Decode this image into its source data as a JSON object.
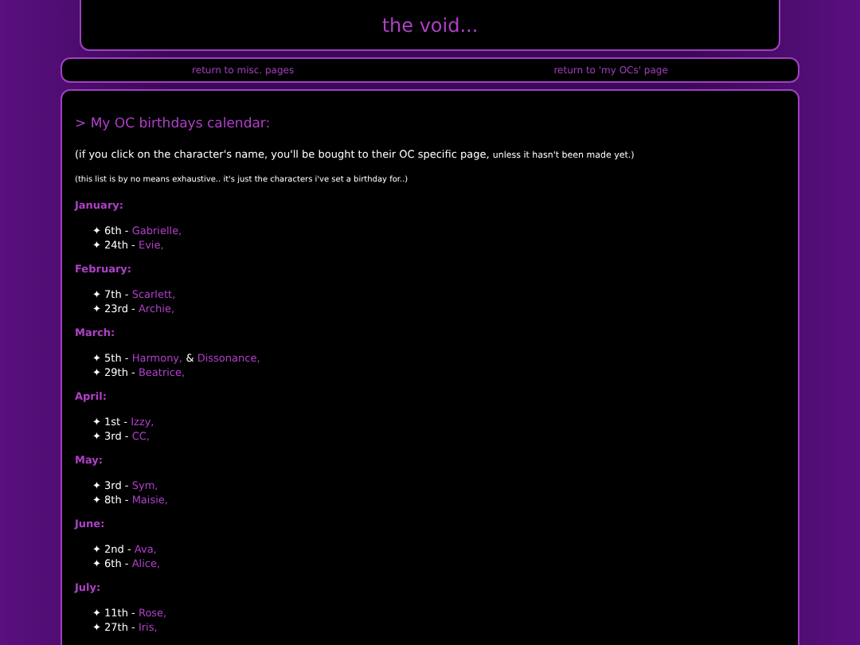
{
  "site_title": "the void...",
  "nav": [
    {
      "label": "return to misc. pages"
    },
    {
      "label": "return to 'my OCs' page"
    }
  ],
  "heading": "> My OC birthdays calendar:",
  "intro": {
    "text": "(if you click on the character's name, you'll be bought to their OC specific page,",
    "small_text": "unless it hasn't been made yet.)"
  },
  "note": "(this list is by no means exhaustive.. it's just the characters i've set a birthday for..)",
  "months": [
    {
      "name": "January:",
      "entries": [
        {
          "bullet": "✦",
          "date": "6th -",
          "parts": [
            {
              "kind": "link",
              "text": "Gabrielle,"
            }
          ]
        },
        {
          "bullet": "✦",
          "date": "24th -",
          "parts": [
            {
              "kind": "link",
              "text": "Evie,"
            }
          ]
        }
      ]
    },
    {
      "name": "February:",
      "entries": [
        {
          "bullet": "✦",
          "date": "7th -",
          "parts": [
            {
              "kind": "link",
              "text": "Scarlett,"
            }
          ]
        },
        {
          "bullet": "✦",
          "date": "23rd -",
          "parts": [
            {
              "kind": "link",
              "text": "Archie,"
            }
          ]
        }
      ]
    },
    {
      "name": "March:",
      "entries": [
        {
          "bullet": "✦",
          "date": "5th -",
          "parts": [
            {
              "kind": "link",
              "text": "Harmony,"
            },
            {
              "kind": "plain",
              "text": "&"
            },
            {
              "kind": "link",
              "text": "Dissonance,"
            }
          ]
        },
        {
          "bullet": "✦",
          "date": "29th -",
          "parts": [
            {
              "kind": "link",
              "text": "Beatrice,"
            }
          ]
        }
      ]
    },
    {
      "name": "April:",
      "entries": [
        {
          "bullet": "✦",
          "date": "1st -",
          "parts": [
            {
              "kind": "link",
              "text": "Izzy,"
            }
          ]
        },
        {
          "bullet": "✦",
          "date": "3rd -",
          "parts": [
            {
              "kind": "link",
              "text": "CC,"
            }
          ]
        }
      ]
    },
    {
      "name": "May:",
      "entries": [
        {
          "bullet": "✦",
          "date": "3rd -",
          "parts": [
            {
              "kind": "link",
              "text": "Sym,"
            }
          ]
        },
        {
          "bullet": "✦",
          "date": "8th -",
          "parts": [
            {
              "kind": "link",
              "text": "Maisie,"
            }
          ]
        }
      ]
    },
    {
      "name": "June:",
      "entries": [
        {
          "bullet": "✦",
          "date": "2nd -",
          "parts": [
            {
              "kind": "link",
              "text": "Ava,"
            }
          ]
        },
        {
          "bullet": "✦",
          "date": "6th -",
          "parts": [
            {
              "kind": "link",
              "text": "Alice,"
            }
          ]
        }
      ]
    },
    {
      "name": "July:",
      "entries": [
        {
          "bullet": "✦",
          "date": "11th -",
          "parts": [
            {
              "kind": "link",
              "text": "Rose,"
            }
          ]
        },
        {
          "bullet": "✦",
          "date": "27th -",
          "parts": [
            {
              "kind": "link",
              "text": "Iris,"
            }
          ]
        }
      ]
    }
  ]
}
